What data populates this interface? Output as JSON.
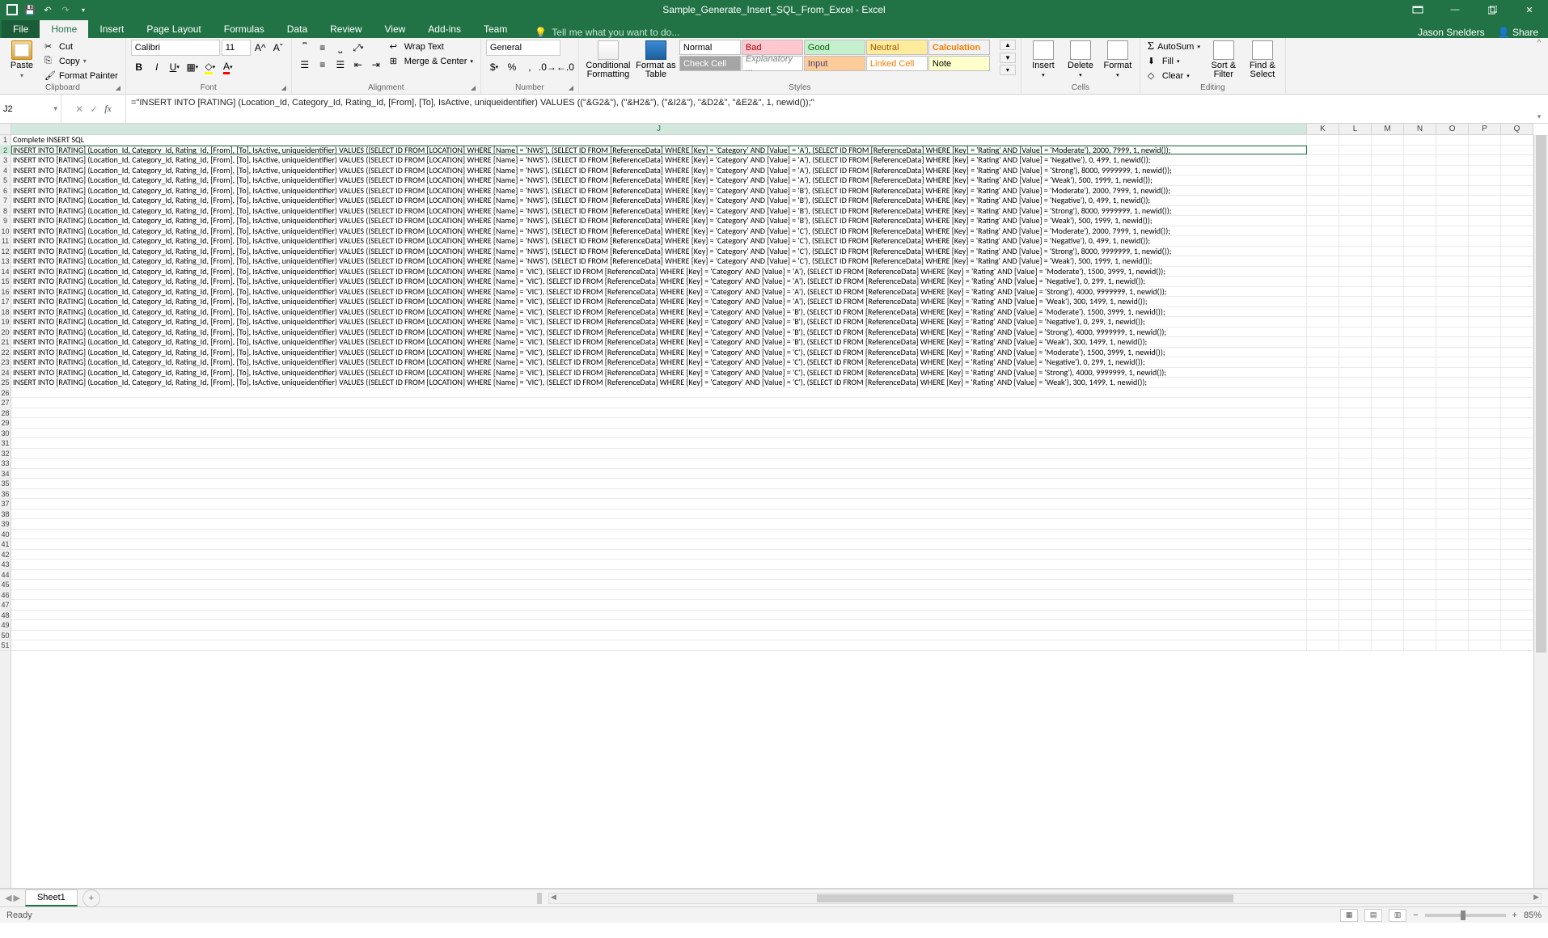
{
  "title": "Sample_Generate_Insert_SQL_From_Excel - Excel",
  "user": "Jason Snelders",
  "share_label": "Share",
  "tabs": [
    "File",
    "Home",
    "Insert",
    "Page Layout",
    "Formulas",
    "Data",
    "Review",
    "View",
    "Add-ins",
    "Team"
  ],
  "active_tab": "Home",
  "tell_me": "Tell me what you want to do...",
  "clipboard": {
    "paste": "Paste",
    "cut": "Cut",
    "copy": "Copy",
    "painter": "Format Painter",
    "label": "Clipboard"
  },
  "font": {
    "name": "Calibri",
    "size": "11",
    "label": "Font"
  },
  "alignment": {
    "wrap": "Wrap Text",
    "merge": "Merge & Center",
    "label": "Alignment"
  },
  "number": {
    "format": "General",
    "label": "Number"
  },
  "styles": {
    "cf": "Conditional\nFormatting",
    "fat": "Format as\nTable",
    "label": "Styles",
    "cells": [
      {
        "key": "normal",
        "text": "Normal"
      },
      {
        "key": "bad",
        "text": "Bad"
      },
      {
        "key": "good",
        "text": "Good"
      },
      {
        "key": "neutral",
        "text": "Neutral"
      },
      {
        "key": "calc",
        "text": "Calculation"
      },
      {
        "key": "check",
        "text": "Check Cell"
      },
      {
        "key": "expl",
        "text": "Explanatory ..."
      },
      {
        "key": "input",
        "text": "Input"
      },
      {
        "key": "linked",
        "text": "Linked Cell"
      },
      {
        "key": "note",
        "text": "Note"
      }
    ]
  },
  "cells_group": {
    "insert": "Insert",
    "delete": "Delete",
    "format": "Format",
    "label": "Cells"
  },
  "editing": {
    "sum": "AutoSum",
    "fill": "Fill",
    "clear": "Clear",
    "sort": "Sort &\nFilter",
    "find": "Find &\nSelect",
    "label": "Editing"
  },
  "namebox": "J2",
  "formula": "=\"INSERT INTO [RATING] (Location_Id, Category_Id, Rating_Id, [From], [To], IsActive, uniqueidentifier) VALUES ((\"&G2&\"), (\"&H2&\"), (\"&I2&\"), \"&D2&\", \"&E2&\", 1, newid());\"",
  "columns": [
    "J",
    "K",
    "L",
    "M",
    "N",
    "O",
    "P",
    "Q"
  ],
  "row_start": 1,
  "row_count": 51,
  "header_row": "Complete INSERT SQL",
  "sql_base": "INSERT INTO [RATING] (Location_Id, Category_Id, Rating_Id, [From], [To], IsActive, uniqueidentifier) VALUES ((SELECT ID FROM [LOCATION] WHERE [Name] = '{loc}'), (SELECT ID FROM [ReferenceData] WHERE [Key] = 'Category' AND [Value] = '{cat}'), (SELECT ID FROM [ReferenceData] WHERE [Key] = 'Rating' AND [Value] = '{rat}'), {from}, {to}, 1, newid());",
  "rows_data": [
    {
      "loc": "NWS",
      "cat": "A",
      "rat": "Moderate",
      "from": "2000",
      "to": "7999"
    },
    {
      "loc": "NWS",
      "cat": "A",
      "rat": "Negative",
      "from": "0",
      "to": "499"
    },
    {
      "loc": "NWS",
      "cat": "A",
      "rat": "Strong",
      "from": "8000",
      "to": "9999999"
    },
    {
      "loc": "NWS",
      "cat": "A",
      "rat": "Weak",
      "from": "500",
      "to": "1999"
    },
    {
      "loc": "NWS",
      "cat": "B",
      "rat": "Moderate",
      "from": "2000",
      "to": "7999"
    },
    {
      "loc": "NWS",
      "cat": "B",
      "rat": "Negative",
      "from": "0",
      "to": "499"
    },
    {
      "loc": "NWS",
      "cat": "B",
      "rat": "Strong",
      "from": "8000",
      "to": "9999999"
    },
    {
      "loc": "NWS",
      "cat": "B",
      "rat": "Weak",
      "from": "500",
      "to": "1999"
    },
    {
      "loc": "NWS",
      "cat": "C",
      "rat": "Moderate",
      "from": "2000",
      "to": "7999"
    },
    {
      "loc": "NWS",
      "cat": "C",
      "rat": "Negative",
      "from": "0",
      "to": "499"
    },
    {
      "loc": "NWS",
      "cat": "C",
      "rat": "Strong",
      "from": "8000",
      "to": "9999999"
    },
    {
      "loc": "NWS",
      "cat": "C",
      "rat": "Weak",
      "from": "500",
      "to": "1999"
    },
    {
      "loc": "VIC",
      "cat": "A",
      "rat": "Moderate",
      "from": "1500",
      "to": "3999"
    },
    {
      "loc": "VIC",
      "cat": "A",
      "rat": "Negative",
      "from": "0",
      "to": "299"
    },
    {
      "loc": "VIC",
      "cat": "A",
      "rat": "Strong",
      "from": "4000",
      "to": "9999999"
    },
    {
      "loc": "VIC",
      "cat": "A",
      "rat": "Weak",
      "from": "300",
      "to": "1499"
    },
    {
      "loc": "VIC",
      "cat": "B",
      "rat": "Moderate",
      "from": "1500",
      "to": "3999"
    },
    {
      "loc": "VIC",
      "cat": "B",
      "rat": "Negative",
      "from": "0",
      "to": "299"
    },
    {
      "loc": "VIC",
      "cat": "B",
      "rat": "Strong",
      "from": "4000",
      "to": "9999999"
    },
    {
      "loc": "VIC",
      "cat": "B",
      "rat": "Weak",
      "from": "300",
      "to": "1499"
    },
    {
      "loc": "VIC",
      "cat": "C",
      "rat": "Moderate",
      "from": "1500",
      "to": "3999"
    },
    {
      "loc": "VIC",
      "cat": "C",
      "rat": "Negative",
      "from": "0",
      "to": "299"
    },
    {
      "loc": "VIC",
      "cat": "C",
      "rat": "Strong",
      "from": "4000",
      "to": "9999999"
    },
    {
      "loc": "VIC",
      "cat": "C",
      "rat": "Weak",
      "from": "300",
      "to": "1499"
    }
  ],
  "sheet": {
    "name": "Sheet1"
  },
  "status": {
    "ready": "Ready",
    "zoom": "85%"
  }
}
